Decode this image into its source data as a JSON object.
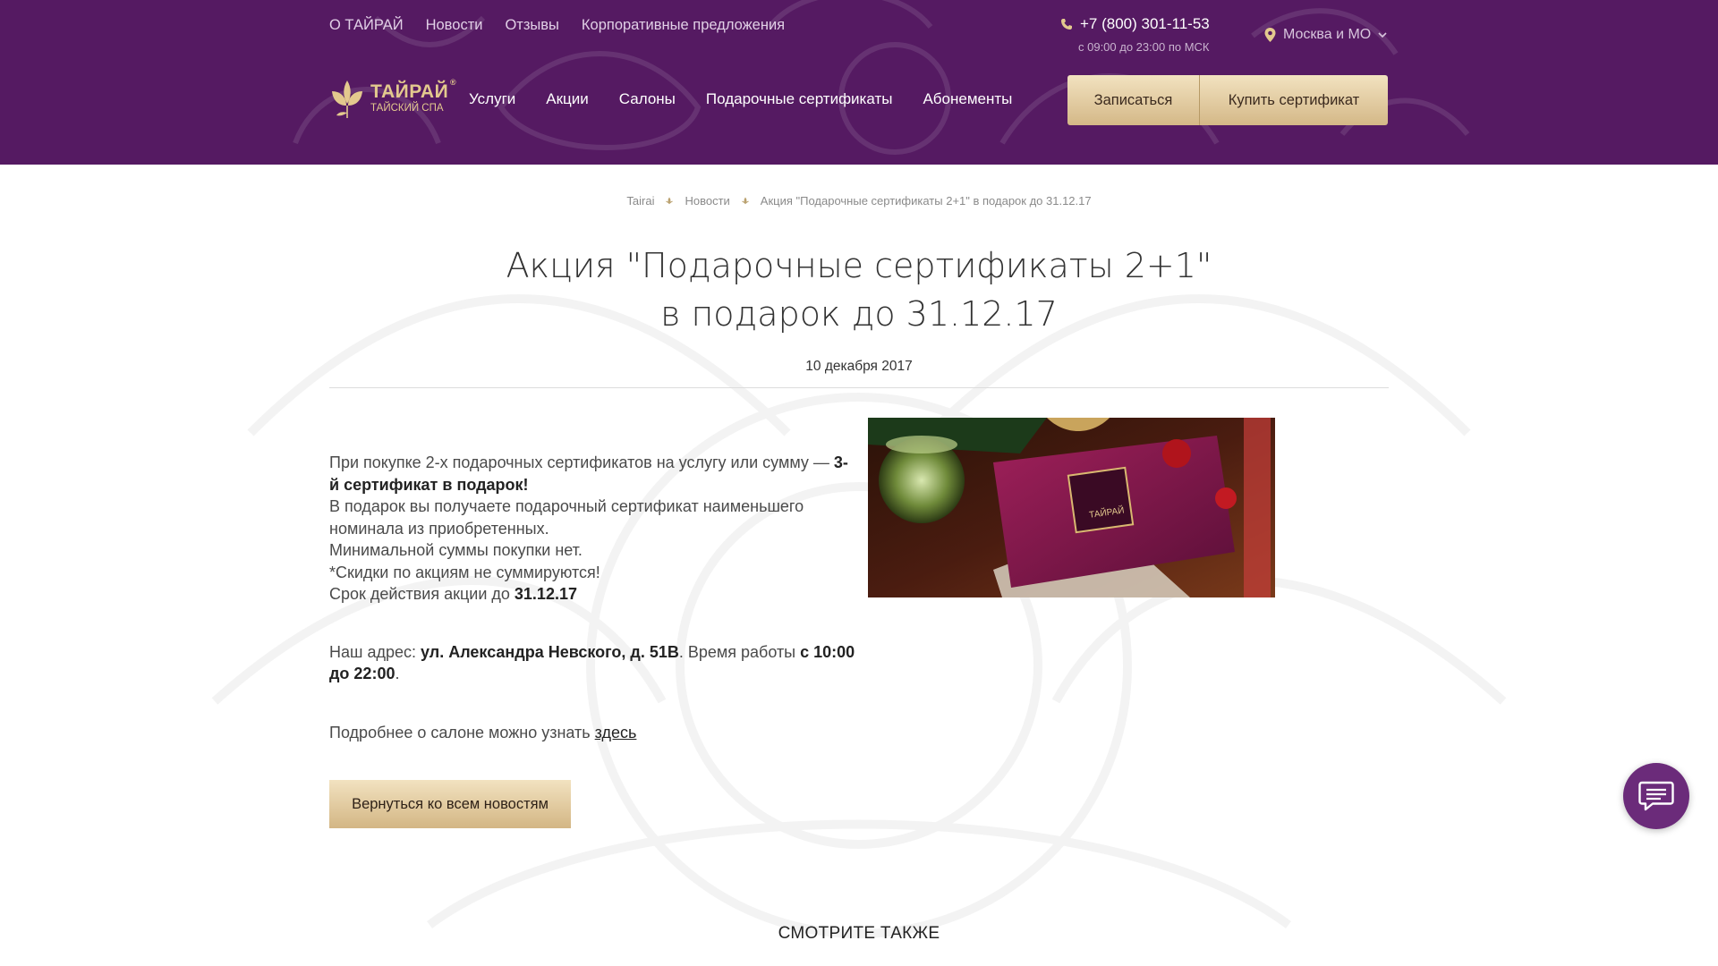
{
  "top_nav": [
    "О ТАЙРАЙ",
    "Новости",
    "Отзывы",
    "Корпоративные предложения"
  ],
  "phone": {
    "number": "+7 (800) 301-11-53",
    "hours": "с 09:00 до 23:00 по МСК"
  },
  "city": "Москва и МО",
  "logo": {
    "name": "ТАЙРАЙ",
    "sub": "ТАЙСКИЙ СПА",
    "mark": "®"
  },
  "main_nav": [
    "Услуги",
    "Акции",
    "Салоны",
    "Подарочные сертификаты",
    "Абонементы"
  ],
  "buttons": {
    "book": "Записаться",
    "buy_cert": "Купить сертификат",
    "back": "Вернуться ко всем новостям"
  },
  "breadcrumb": [
    "Tairai",
    "Новости",
    "Акция \"Подарочные сертификаты 2+1\" в подарок до 31.12.17"
  ],
  "article": {
    "title": "Акция \"Подарочные сертификаты 2+1\" в подарок до 31.12.17",
    "date": "10 декабря 2017",
    "p1_a": "При покупке 2-х подарочных сертификатов на услугу или сумму — ",
    "p1_b": "3-й сертификат в подарок!",
    "p2": "В подарок вы получаете подарочный сертификат наименьшего номинала из приобретенных.",
    "p3": "Минимальной суммы покупки нет.",
    "p4": "*Скидки по акциям не суммируются!",
    "p5_a": "Срок действия акции до ",
    "p5_b": "31.12.17",
    "addr_a": "Наш адрес: ",
    "addr_b": "ул. Александра Невского, д. 51В",
    "addr_c": ". Время работы ",
    "addr_d": "с 10:00 до 22:00",
    "addr_e": ".",
    "more_a": "Подробнее о салоне можно узнать ",
    "more_link": "здесь",
    "image_label": "ТАЙРАЙ"
  },
  "see_also": "СМОТРИТЕ ТАКЖЕ",
  "colors": {
    "header_bg": "#551a62",
    "gold": "#e3c98e",
    "chat": "#6b2b7a"
  },
  "icons": [
    "phone-icon",
    "location-pin-icon",
    "chevron-down-icon",
    "lotus-logo-icon",
    "breadcrumb-separator-icon",
    "chat-icon"
  ]
}
